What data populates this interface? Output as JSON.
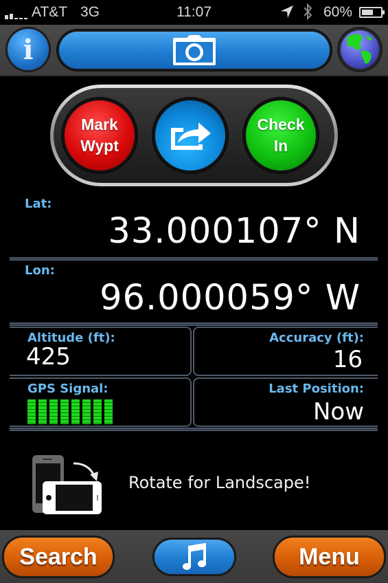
{
  "status_bar": {
    "signal_bars": 2,
    "signal_max": 5,
    "carrier": "AT&T",
    "network": "3G",
    "time": "11:07",
    "location_icon": "location-arrow-icon",
    "bluetooth_icon": "bluetooth-icon",
    "battery_percent_label": "60%",
    "battery_level": 0.6
  },
  "toolbar": {
    "info_icon": "info-icon",
    "info_glyph": "i",
    "camera_icon": "camera-icon",
    "globe_icon": "globe-icon"
  },
  "actions": {
    "mark_waypoint": {
      "line1": "Mark",
      "line2": "Wypt",
      "color": "#d90a0a"
    },
    "share": {
      "icon": "share-arrow-icon",
      "color": "#0c86d8"
    },
    "check_in": {
      "line1": "Check",
      "line2": "In",
      "color": "#10c010"
    }
  },
  "coordinates": {
    "lat_label": "Lat:",
    "lat_value": "33.000107° N",
    "lon_label": "Lon:",
    "lon_value": "96.000059° W"
  },
  "stats": {
    "altitude_label": "Altitude (ft):",
    "altitude_value": "425",
    "accuracy_label": "Accuracy (ft):",
    "accuracy_value": "16",
    "gps_signal_label": "GPS Signal:",
    "gps_signal_bars": 8,
    "gps_signal_max": 8,
    "last_position_label": "Last Position:",
    "last_position_value": "Now"
  },
  "rotate_hint": {
    "icon": "rotate-device-icon",
    "text": "Rotate for Landscape!"
  },
  "bottom_bar": {
    "search_label": "Search",
    "music_icon": "music-note-icon",
    "menu_label": "Menu"
  },
  "colors": {
    "label_blue": "#6ab8ee",
    "accent_orange": "#d85e08",
    "accent_blue": "#1f7dd2",
    "gps_green": "#1dd81d"
  }
}
